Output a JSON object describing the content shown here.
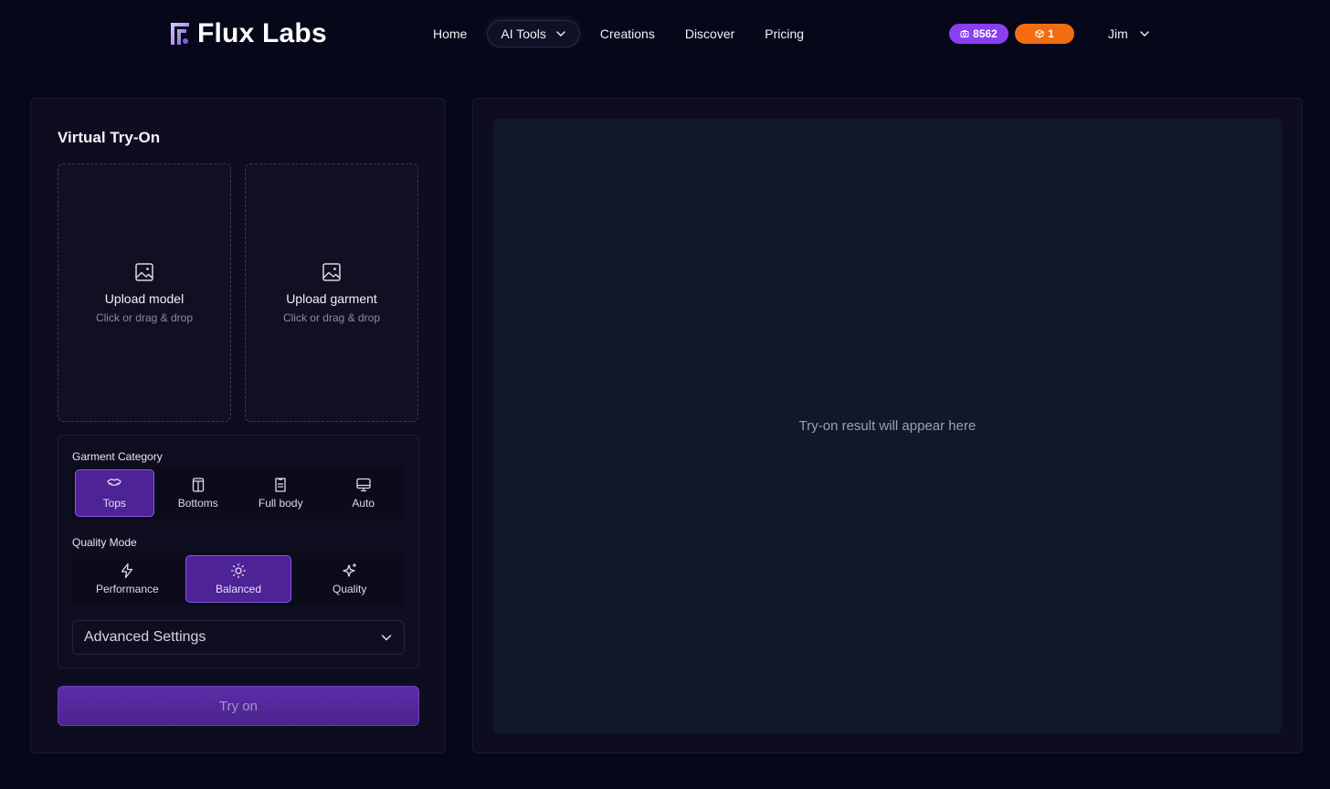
{
  "brand": {
    "name": "Flux Labs"
  },
  "nav": {
    "items": [
      {
        "label": "Home"
      },
      {
        "label": "AI Tools"
      },
      {
        "label": "Creations"
      },
      {
        "label": "Discover"
      },
      {
        "label": "Pricing"
      }
    ]
  },
  "badges": {
    "credits": "8562",
    "boxes": "1"
  },
  "user": {
    "name": "Jim"
  },
  "panel": {
    "title": "Virtual Try-On",
    "upload_model": {
      "title": "Upload model",
      "subtitle": "Click or drag & drop"
    },
    "upload_garment": {
      "title": "Upload garment",
      "subtitle": "Click or drag & drop"
    },
    "garment_category": {
      "label": "Garment Category",
      "options": [
        {
          "label": "Tops",
          "icon": "shirt-icon",
          "active": true
        },
        {
          "label": "Bottoms",
          "icon": "pants-icon",
          "active": false
        },
        {
          "label": "Full body",
          "icon": "dress-icon",
          "active": false
        },
        {
          "label": "Auto",
          "icon": "monitor-icon",
          "active": false
        }
      ]
    },
    "quality_mode": {
      "label": "Quality Mode",
      "options": [
        {
          "label": "Performance",
          "icon": "bolt-icon",
          "active": false
        },
        {
          "label": "Balanced",
          "icon": "sun-icon",
          "active": true
        },
        {
          "label": "Quality",
          "icon": "sparkles-icon",
          "active": false
        }
      ]
    },
    "advanced_settings": "Advanced Settings",
    "try_on_button": "Try on"
  },
  "result": {
    "placeholder": "Try-on result will appear here"
  },
  "colors": {
    "background": "#07071a",
    "accent_purple": "#8a3ff0",
    "accent_orange": "#f26d10",
    "active_segment": "#4d2396"
  }
}
